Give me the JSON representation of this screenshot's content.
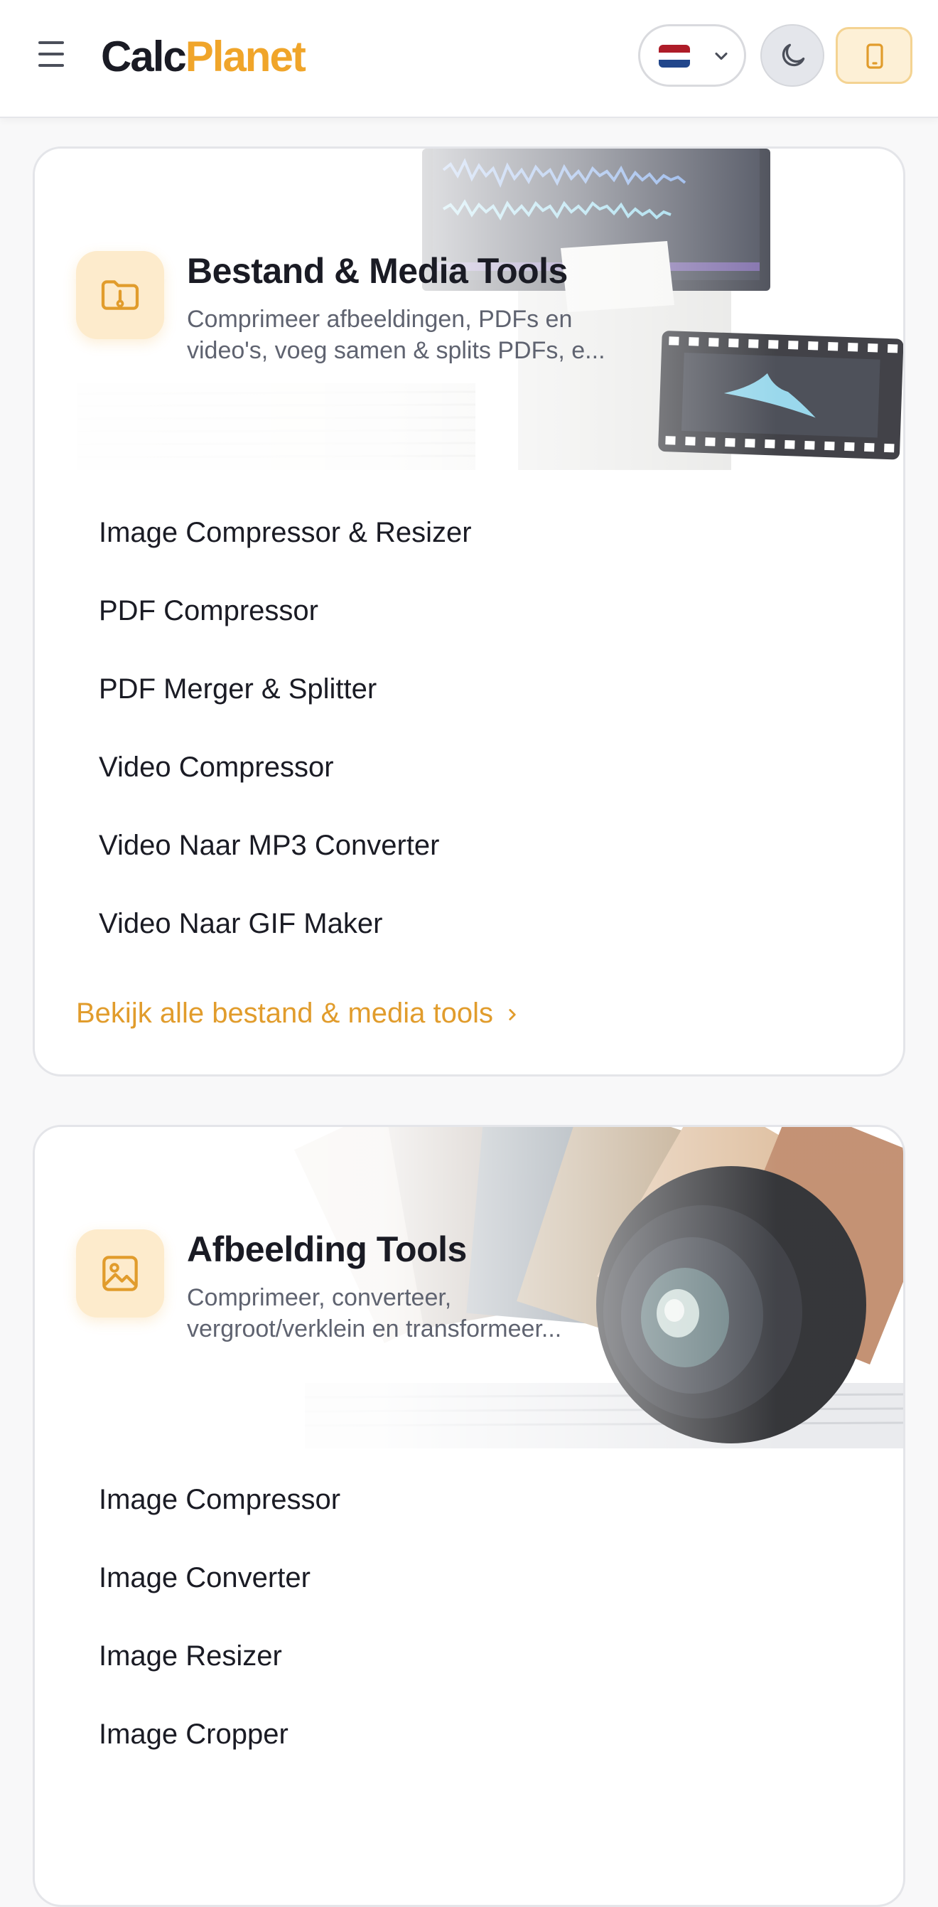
{
  "header": {
    "logo_part1": "Calc",
    "logo_part2": "Planet",
    "language_flag": "netherlands-flag",
    "icons": {
      "menu": "hamburger-menu-icon",
      "language_dropdown": "chevron-down-icon",
      "theme": "moon-icon",
      "device": "smartphone-icon"
    }
  },
  "colors": {
    "accent": "#f0a52a",
    "link": "#e19c2c",
    "icon_bg": "#fdebcc",
    "text": "#1a1b24",
    "muted": "#5f6370"
  },
  "categories": [
    {
      "title": "Bestand & Media Tools",
      "description": "Comprimeer afbeeldingen, PDFs en video's, voeg samen & splits PDFs, e...",
      "icon": "folder-file-icon",
      "tools": [
        "Image Compressor & Resizer",
        "PDF Compressor",
        "PDF Merger & Splitter",
        "Video Compressor",
        "Video Naar MP3 Converter",
        "Video Naar GIF Maker"
      ],
      "see_all": "Bekijk alle bestand & media tools"
    },
    {
      "title": "Afbeelding Tools",
      "description": "Comprimeer, converteer, vergroot/verklein en transformeer...",
      "icon": "image-icon",
      "tools": [
        "Image Compressor",
        "Image Converter",
        "Image Resizer",
        "Image Cropper"
      ]
    }
  ]
}
